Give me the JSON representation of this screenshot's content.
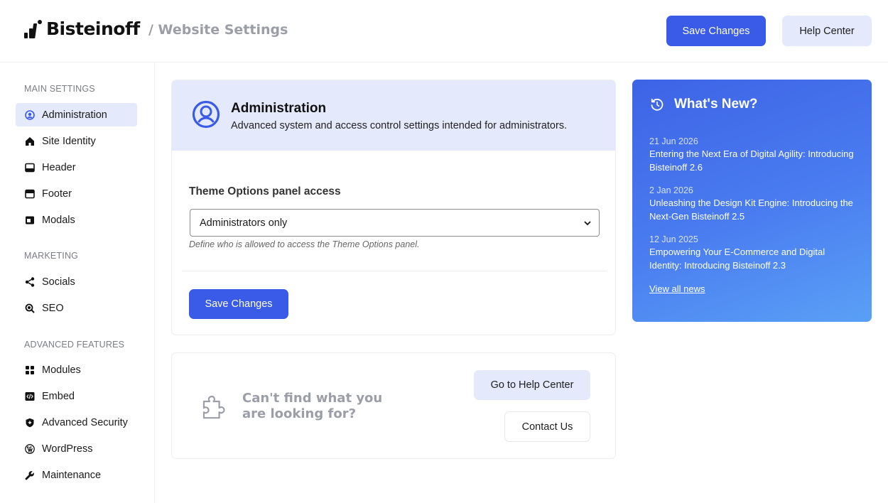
{
  "header": {
    "brand": "Bisteinoff",
    "breadcrumb": "/ Website Settings",
    "save_label": "Save Changes",
    "help_label": "Help Center"
  },
  "sidebar": {
    "sections": [
      {
        "title": "MAIN SETTINGS",
        "items": [
          {
            "label": "Administration",
            "icon": "user-circle-icon",
            "active": true
          },
          {
            "label": "Site Identity",
            "icon": "home-icon"
          },
          {
            "label": "Header",
            "icon": "header-layout-icon"
          },
          {
            "label": "Footer",
            "icon": "footer-layout-icon"
          },
          {
            "label": "Modals",
            "icon": "modal-window-icon"
          }
        ]
      },
      {
        "title": "MARKETING",
        "items": [
          {
            "label": "Socials",
            "icon": "share-icon"
          },
          {
            "label": "SEO",
            "icon": "magnifier-icon"
          }
        ]
      },
      {
        "title": "ADVANCED FEATURES",
        "items": [
          {
            "label": "Modules",
            "icon": "grid-icon"
          },
          {
            "label": "Embed",
            "icon": "code-icon"
          },
          {
            "label": "Advanced Security",
            "icon": "shield-icon"
          },
          {
            "label": "WordPress",
            "icon": "wordpress-icon"
          },
          {
            "label": "Maintenance",
            "icon": "wrench-icon"
          }
        ]
      }
    ]
  },
  "admin": {
    "title": "Administration",
    "subtitle": "Advanced system and access control settings intended for administrators.",
    "field_label": "Theme Options panel access",
    "select_value": "Administrators only",
    "hint": "Define who is allowed to access the Theme Options panel.",
    "save_label": "Save Changes"
  },
  "help": {
    "text": "Can't find what you are looking for?",
    "goto_label": "Go to Help Center",
    "contact_label": "Contact Us"
  },
  "news": {
    "title": "What's New?",
    "items": [
      {
        "date": "21 Jun 2026",
        "headline": "Entering the Next Era of Digital Agility: Introducing Bisteinoff 2.6"
      },
      {
        "date": "2 Jan 2026",
        "headline": "Unleashing the Design Kit Engine: Introducing the Next-Gen Bisteinoff 2.5"
      },
      {
        "date": "12 Jun 2025",
        "headline": "Empowering Your E-Commerce and Digital Identity: Introducing Bisteinoff 2.3"
      }
    ],
    "view_all": "View all news"
  },
  "colors": {
    "accent": "#3a5be8",
    "accent_soft": "#e4e9fb",
    "muted_text": "#9b9ea6"
  }
}
